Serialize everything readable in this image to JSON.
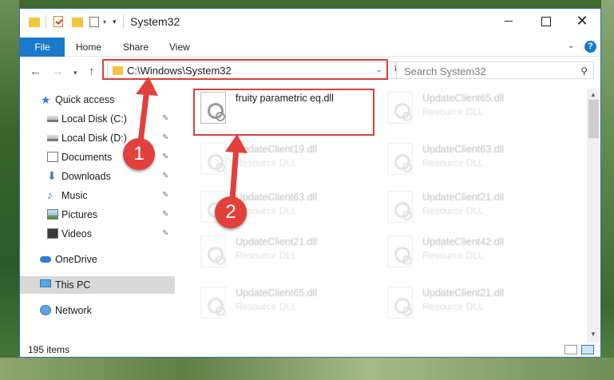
{
  "window": {
    "title": "System32",
    "controls": {
      "minimize": "",
      "maximize": "",
      "close": "✕"
    }
  },
  "quick_access_toolbar": {
    "dropdown": "▾",
    "customize": "▾"
  },
  "ribbon": {
    "tabs": [
      "File",
      "Home",
      "Share",
      "View"
    ],
    "expand": "⌄",
    "help": "?"
  },
  "navigation": {
    "back": "←",
    "forward": "→",
    "recent": "▾",
    "up": "↑"
  },
  "address_bar": {
    "path": "C:\\Windows\\System32",
    "dropdown": "⌄",
    "refresh": "↻"
  },
  "search": {
    "placeholder": "Search System32",
    "icon": "⚲"
  },
  "nav_pane": {
    "items": [
      {
        "label": "Quick access",
        "icon": "star-icon",
        "pinned": false
      },
      {
        "label": "Local Disk (C:)",
        "icon": "drive-icon",
        "pinned": true
      },
      {
        "label": "Local Disk (D:)",
        "icon": "drive-icon",
        "pinned": true
      },
      {
        "label": "Documents",
        "icon": "documents-icon",
        "pinned": true
      },
      {
        "label": "Downloads",
        "icon": "downloads-icon",
        "pinned": true
      },
      {
        "label": "Music",
        "icon": "music-icon",
        "pinned": true
      },
      {
        "label": "Pictures",
        "icon": "pictures-icon",
        "pinned": true
      },
      {
        "label": "Videos",
        "icon": "videos-icon",
        "pinned": true
      },
      {
        "label": "OneDrive",
        "icon": "cloud-icon",
        "pinned": false
      },
      {
        "label": "This PC",
        "icon": "computer-icon",
        "pinned": false,
        "selected": true
      },
      {
        "label": "Network",
        "icon": "network-icon",
        "pinned": false
      }
    ],
    "pin_glyph": "📌"
  },
  "files": [
    {
      "name": "fruity parametric eq.dll",
      "type": "",
      "highlighted": true
    },
    {
      "name": "UpdateClient65.dll",
      "type": "Resource DLL"
    },
    {
      "name": "UpdateClient19.dll",
      "type": "Resource DLL"
    },
    {
      "name": "UpdateClient63.dll",
      "type": "Resource DLL"
    },
    {
      "name": "UpdateClient63.dll",
      "type": "Resource DLL"
    },
    {
      "name": "UpdateClient21.dll",
      "type": "Resource DLL"
    },
    {
      "name": "UpdateClient21.dll",
      "type": "Resource DLL"
    },
    {
      "name": "UpdateClient42.dll",
      "type": "Resource DLL"
    },
    {
      "name": "UpdateClient65.dll",
      "type": "Resource DLL"
    },
    {
      "name": "UpdateClient21.dll",
      "type": "Resource DLL"
    }
  ],
  "status_bar": {
    "item_count": "195 items"
  },
  "annotations": {
    "step1": "1",
    "step2": "2",
    "color": "#e2403a"
  }
}
